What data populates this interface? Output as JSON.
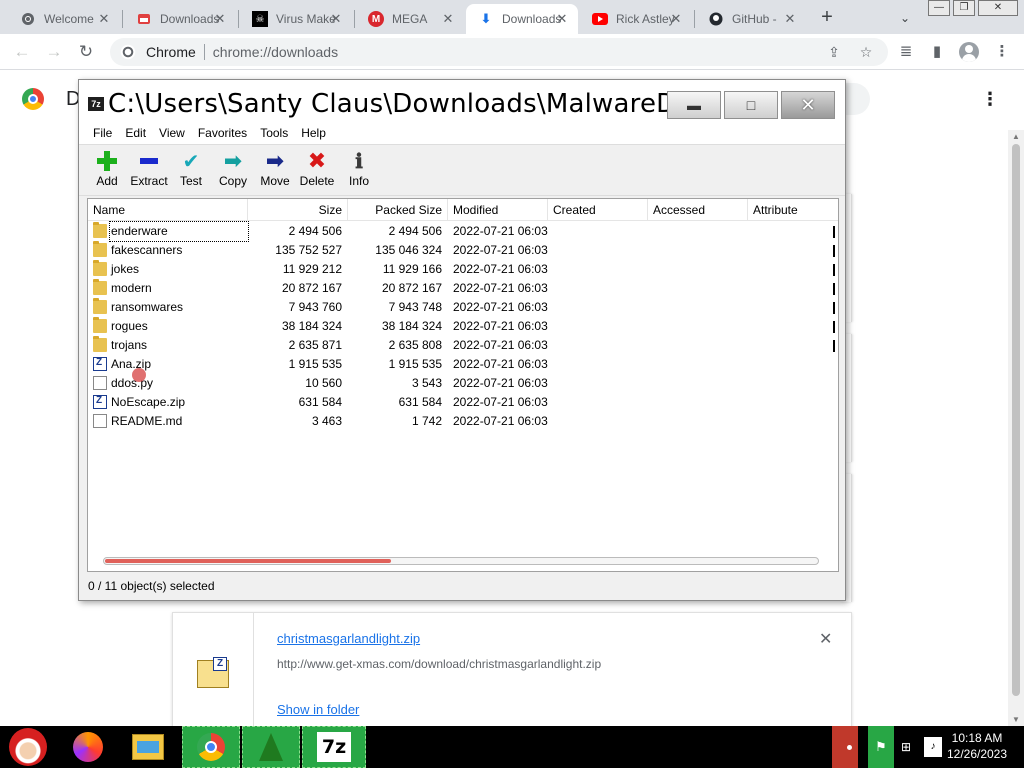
{
  "browser": {
    "tabs": [
      {
        "label": "Welcome",
        "icon": "chrome-icon"
      },
      {
        "label": "Downloads",
        "icon": "download-page-icon"
      },
      {
        "label": "Virus Maker",
        "icon": "skull-icon"
      },
      {
        "label": "MEGA",
        "icon": "mega-icon"
      },
      {
        "label": "Downloads",
        "icon": "download-arrow-icon"
      },
      {
        "label": "Rick Astley",
        "icon": "youtube-icon"
      },
      {
        "label": "GitHub -",
        "icon": "github-icon"
      }
    ],
    "active_tab_index": 4,
    "address": {
      "site": "Chrome",
      "url": "chrome://downloads"
    }
  },
  "downloads_page": {
    "title": "D",
    "item": {
      "file_name": "christmasgarlandlight.zip",
      "url": "http://www.get-xmas.com/download/christmasgarlandlight.zip",
      "show_in_folder": "Show in folder"
    }
  },
  "sevenzip": {
    "title": "C:\\Users\\Santy Claus\\Downloads\\MalwareDa...",
    "menu": [
      "File",
      "Edit",
      "View",
      "Favorites",
      "Tools",
      "Help"
    ],
    "toolbar": [
      {
        "label": "Add",
        "icon": "add-plus-icon"
      },
      {
        "label": "Extract",
        "icon": "extract-minus-icon"
      },
      {
        "label": "Test",
        "icon": "test-check-icon"
      },
      {
        "label": "Copy",
        "icon": "copy-arrow-icon"
      },
      {
        "label": "Move",
        "icon": "move-arrow-icon"
      },
      {
        "label": "Delete",
        "icon": "delete-x-icon"
      },
      {
        "label": "Info",
        "icon": "info-icon"
      }
    ],
    "columns": [
      "Name",
      "Size",
      "Packed Size",
      "Modified",
      "Created",
      "Accessed",
      "Attribute"
    ],
    "rows": [
      {
        "name": "enderware",
        "type": "folder",
        "size": "2 494 506",
        "packed": "2 494 506",
        "modified": "2022-07-21 06:03"
      },
      {
        "name": "fakescanners",
        "type": "folder",
        "size": "135 752 527",
        "packed": "135 046 324",
        "modified": "2022-07-21 06:03"
      },
      {
        "name": "jokes",
        "type": "folder",
        "size": "11 929 212",
        "packed": "11 929 166",
        "modified": "2022-07-21 06:03"
      },
      {
        "name": "modern",
        "type": "folder",
        "size": "20 872 167",
        "packed": "20 872 167",
        "modified": "2022-07-21 06:03"
      },
      {
        "name": "ransomwares",
        "type": "folder",
        "size": "7 943 760",
        "packed": "7 943 748",
        "modified": "2022-07-21 06:03"
      },
      {
        "name": "rogues",
        "type": "folder",
        "size": "38 184 324",
        "packed": "38 184 324",
        "modified": "2022-07-21 06:03"
      },
      {
        "name": "trojans",
        "type": "folder",
        "size": "2 635 871",
        "packed": "2 635 808",
        "modified": "2022-07-21 06:03"
      },
      {
        "name": "Ana.zip",
        "type": "zip",
        "size": "1 915 535",
        "packed": "1 915 535",
        "modified": "2022-07-21 06:03"
      },
      {
        "name": "ddos.py",
        "type": "file",
        "size": "10 560",
        "packed": "3 543",
        "modified": "2022-07-21 06:03"
      },
      {
        "name": "NoEscape.zip",
        "type": "zip",
        "size": "631 584",
        "packed": "631 584",
        "modified": "2022-07-21 06:03"
      },
      {
        "name": "README.md",
        "type": "file",
        "size": "3 463",
        "packed": "1 742",
        "modified": "2022-07-21 06:03"
      }
    ],
    "status": "0 / 11 object(s) selected"
  },
  "taskbar": {
    "time": "10:18 AM",
    "date": "12/26/2023"
  },
  "colors": {
    "tab_strip": "#dee1e6",
    "link": "#1a73e8",
    "taskbar": "#000000",
    "taskbar_highlight": "#28a745",
    "scroll_thumb": "#e0615a"
  }
}
